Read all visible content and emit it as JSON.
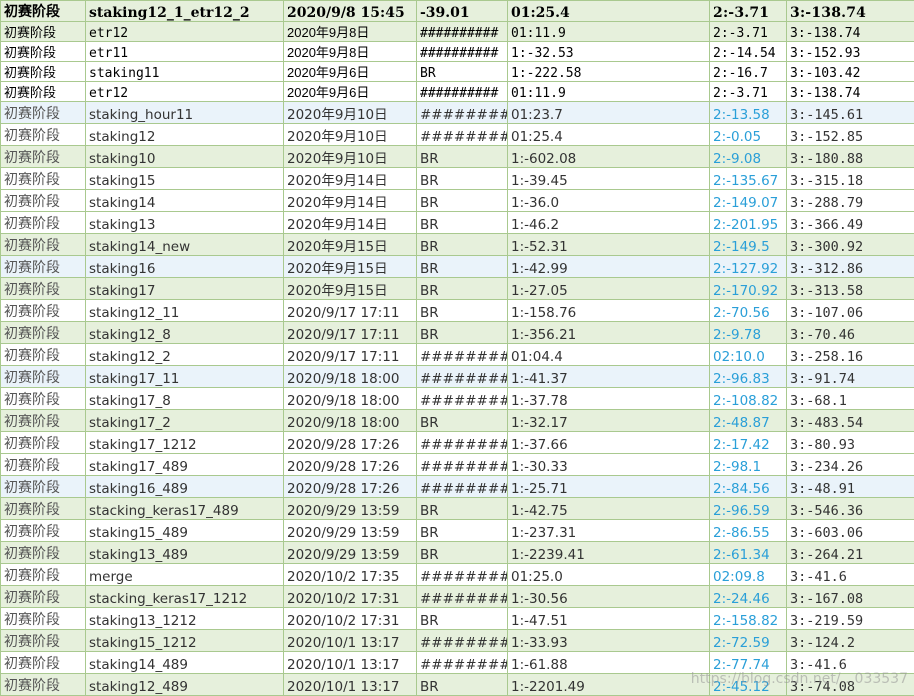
{
  "header": [
    "初赛阶段",
    "staking12_1_etr12_2",
    "2020/9/8 15:45",
    "-39.01",
    "01:25.4",
    "2:-3.71",
    "3:-138.74"
  ],
  "rows": [
    {
      "stage": "初赛阶段",
      "name": "etr12",
      "date": "2020年9月8日",
      "score": "##########",
      "v1": "01:11.9",
      "v2": "2:-3.71",
      "v3": "3:-138.74"
    },
    {
      "stage": "初赛阶段",
      "name": "etr11",
      "date": "2020年9月8日",
      "score": "##########",
      "v1": "1:-32.53",
      "v2": "2:-14.54",
      "v3": "3:-152.93"
    },
    {
      "stage": "初赛阶段",
      "name": "staking11",
      "date": "2020年9月6日",
      "score": "BR",
      "v1": "1:-222.58",
      "v2": "2:-16.7",
      "v3": "3:-103.42"
    },
    {
      "stage": "初赛阶段",
      "name": "etr12",
      "date": "2020年9月6日",
      "score": "##########",
      "v1": "01:11.9",
      "v2": "2:-3.71",
      "v3": "3:-138.74"
    },
    {
      "stage": "初赛阶段",
      "name": "staking_hour11",
      "date": "2020年9月10日",
      "score": "#########",
      "v1": "01:23.7",
      "v2": "2:-13.58",
      "v3": "3:-145.61"
    },
    {
      "stage": "初赛阶段",
      "name": "staking12",
      "date": "2020年9月10日",
      "score": "#########",
      "v1": "01:25.4",
      "v2": "2:-0.05",
      "v3": "3:-152.85"
    },
    {
      "stage": "初赛阶段",
      "name": "staking10",
      "date": "2020年9月10日",
      "score": "BR",
      "v1": "1:-602.08",
      "v2": "2:-9.08",
      "v3": "3:-180.88"
    },
    {
      "stage": "初赛阶段",
      "name": "staking15",
      "date": "2020年9月14日",
      "score": "BR",
      "v1": "1:-39.45",
      "v2": "2:-135.67",
      "v3": "3:-315.18"
    },
    {
      "stage": "初赛阶段",
      "name": "staking14",
      "date": "2020年9月14日",
      "score": "BR",
      "v1": "1:-36.0",
      "v2": "2:-149.07",
      "v3": "3:-288.79"
    },
    {
      "stage": "初赛阶段",
      "name": "staking13",
      "date": "2020年9月14日",
      "score": "BR",
      "v1": "1:-46.2",
      "v2": "2:-201.95",
      "v3": "3:-366.49"
    },
    {
      "stage": "初赛阶段",
      "name": "staking14_new",
      "date": "2020年9月15日",
      "score": "BR",
      "v1": "1:-52.31",
      "v2": "2:-149.5",
      "v3": "3:-300.92"
    },
    {
      "stage": "初赛阶段",
      "name": "staking16",
      "date": "2020年9月15日",
      "score": "BR",
      "v1": "1:-42.99",
      "v2": "2:-127.92",
      "v3": "3:-312.86"
    },
    {
      "stage": "初赛阶段",
      "name": "staking17",
      "date": "2020年9月15日",
      "score": "BR",
      "v1": "1:-27.05",
      "v2": "2:-170.92",
      "v3": "3:-313.58"
    },
    {
      "stage": "初赛阶段",
      "name": "staking12_11",
      "date": "2020/9/17 17:11",
      "score": "BR",
      "v1": "1:-158.76",
      "v2": "2:-70.56",
      "v3": "3:-107.06"
    },
    {
      "stage": "初赛阶段",
      "name": "staking12_8",
      "date": "2020/9/17 17:11",
      "score": "BR",
      "v1": "1:-356.21",
      "v2": "2:-9.78",
      "v3": "3:-70.46"
    },
    {
      "stage": "初赛阶段",
      "name": "staking12_2",
      "date": "2020/9/17 17:11",
      "score": "#########",
      "v1": "01:04.4",
      "v2": "02:10.0",
      "v3": "3:-258.16"
    },
    {
      "stage": "初赛阶段",
      "name": "staking17_11",
      "date": "2020/9/18 18:00",
      "score": "#########",
      "v1": "1:-41.37",
      "v2": "2:-96.83",
      "v3": "3:-91.74"
    },
    {
      "stage": "初赛阶段",
      "name": "staking17_8",
      "date": "2020/9/18 18:00",
      "score": "#########",
      "v1": "1:-37.78",
      "v2": "2:-108.82",
      "v3": "3:-68.1"
    },
    {
      "stage": "初赛阶段",
      "name": "staking17_2",
      "date": "2020/9/18 18:00",
      "score": "BR",
      "v1": "1:-32.17",
      "v2": "2:-48.87",
      "v3": "3:-483.54"
    },
    {
      "stage": "初赛阶段",
      "name": "staking17_1212",
      "date": "2020/9/28 17:26",
      "score": "#########",
      "v1": "1:-37.66",
      "v2": "2:-17.42",
      "v3": "3:-80.93"
    },
    {
      "stage": "初赛阶段",
      "name": "staking17_489",
      "date": "2020/9/28 17:26",
      "score": "#########",
      "v1": "1:-30.33",
      "v2": "2:-98.1",
      "v3": "3:-234.26"
    },
    {
      "stage": "初赛阶段",
      "name": "staking16_489",
      "date": "2020/9/28 17:26",
      "score": "#########",
      "v1": "1:-25.71",
      "v2": "2:-84.56",
      "v3": "3:-48.91"
    },
    {
      "stage": "初赛阶段",
      "name": "stacking_keras17_489",
      "date": "2020/9/29 13:59",
      "score": "BR",
      "v1": "1:-42.75",
      "v2": "2:-96.59",
      "v3": "3:-546.36"
    },
    {
      "stage": "初赛阶段",
      "name": "staking15_489",
      "date": "2020/9/29 13:59",
      "score": "BR",
      "v1": "1:-237.31",
      "v2": "2:-86.55",
      "v3": "3:-603.06"
    },
    {
      "stage": "初赛阶段",
      "name": "staking13_489",
      "date": "2020/9/29 13:59",
      "score": "BR",
      "v1": "1:-2239.41",
      "v2": "2:-61.34",
      "v3": "3:-264.21"
    },
    {
      "stage": "初赛阶段",
      "name": "merge",
      "date": "2020/10/2 17:35",
      "score": "#########",
      "v1": "01:25.0",
      "v2": "02:09.8",
      "v3": "3:-41.6"
    },
    {
      "stage": "初赛阶段",
      "name": "stacking_keras17_1212",
      "date": "2020/10/2 17:31",
      "score": "#########",
      "v1": "1:-30.56",
      "v2": "2:-24.46",
      "v3": "3:-167.08"
    },
    {
      "stage": "初赛阶段",
      "name": "staking13_1212",
      "date": "2020/10/2 17:31",
      "score": "BR",
      "v1": "1:-47.51",
      "v2": "2:-158.82",
      "v3": "3:-219.59"
    },
    {
      "stage": "初赛阶段",
      "name": "staking15_1212",
      "date": "2020/10/1 13:17",
      "score": "#########",
      "v1": "1:-33.93",
      "v2": "2:-72.59",
      "v3": "3:-124.2"
    },
    {
      "stage": "初赛阶段",
      "name": "staking14_489",
      "date": "2020/10/1 13:17",
      "score": "#########",
      "v1": "1:-61.88",
      "v2": "2:-77.74",
      "v3": "3:-41.6"
    },
    {
      "stage": "初赛阶段",
      "name": "staking12_489",
      "date": "2020/10/1 13:17",
      "score": "BR",
      "v1": "1:-2201.49",
      "v2": "2:-45.12",
      "v3": "3:-74.08"
    }
  ],
  "watermark": "https://blog.csdn.net/…033537"
}
